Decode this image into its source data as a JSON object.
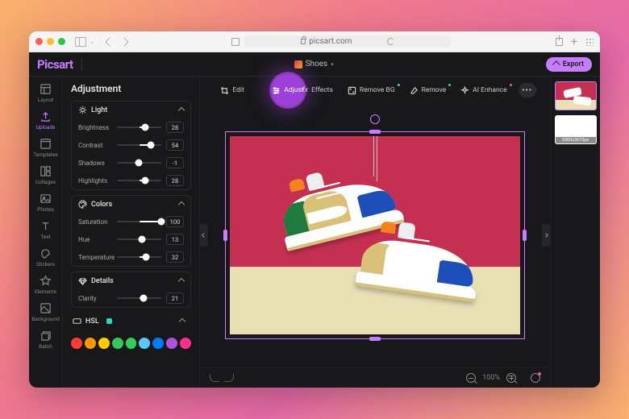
{
  "browser": {
    "url_host": "picsart.com"
  },
  "app": {
    "brand": "Picsart",
    "project_name": "Shoes",
    "export_label": "Export"
  },
  "rail": {
    "items": [
      {
        "key": "layout",
        "label": "Layout"
      },
      {
        "key": "uploads",
        "label": "Uploads"
      },
      {
        "key": "templates",
        "label": "Templates"
      },
      {
        "key": "collages",
        "label": "Collages"
      },
      {
        "key": "photos",
        "label": "Photos"
      },
      {
        "key": "text",
        "label": "Text"
      },
      {
        "key": "stickers",
        "label": "Stickers"
      },
      {
        "key": "elements",
        "label": "Elements"
      },
      {
        "key": "background",
        "label": "Background"
      },
      {
        "key": "batch",
        "label": "Batch"
      }
    ],
    "active": "uploads"
  },
  "panel": {
    "title": "Adjustment",
    "groups": {
      "light": {
        "title": "Light",
        "params": {
          "brightness": {
            "label": "Brightness",
            "value": 28,
            "min": -100,
            "max": 100
          },
          "contrast": {
            "label": "Contrast",
            "value": 54,
            "min": -100,
            "max": 100
          },
          "shadows": {
            "label": "Shadows",
            "value": -1,
            "min": -100,
            "max": 100
          },
          "highlights": {
            "label": "Highlights",
            "value": 28,
            "min": -100,
            "max": 100
          }
        }
      },
      "colors": {
        "title": "Colors",
        "params": {
          "saturation": {
            "label": "Saturation",
            "value": 100,
            "min": -100,
            "max": 100
          },
          "hue": {
            "label": "Hue",
            "value": 13,
            "min": -100,
            "max": 100
          },
          "temperature": {
            "label": "Temperature",
            "value": 32,
            "min": -100,
            "max": 100
          }
        }
      },
      "details": {
        "title": "Details",
        "params": {
          "clarity": {
            "label": "Clarity",
            "value": 21,
            "min": -100,
            "max": 100
          }
        }
      },
      "hsl": {
        "title": "HSL",
        "enabled": true
      }
    },
    "swatches": [
      "#ff3b30",
      "#ff9500",
      "#ffcc00",
      "#34c759",
      "#30d158",
      "#5ac8fa",
      "#007aff",
      "#af52de",
      "#ff2d92"
    ]
  },
  "toolbar": {
    "edit": "Edit",
    "adjust": "Adjust",
    "effects": "Effects",
    "removebg": "Remove BG",
    "remove": "Remove",
    "ai_enhance": "AI Enhance"
  },
  "canvas": {
    "zoom_pct": "100%",
    "dimensions_label": "5500x3672px"
  }
}
